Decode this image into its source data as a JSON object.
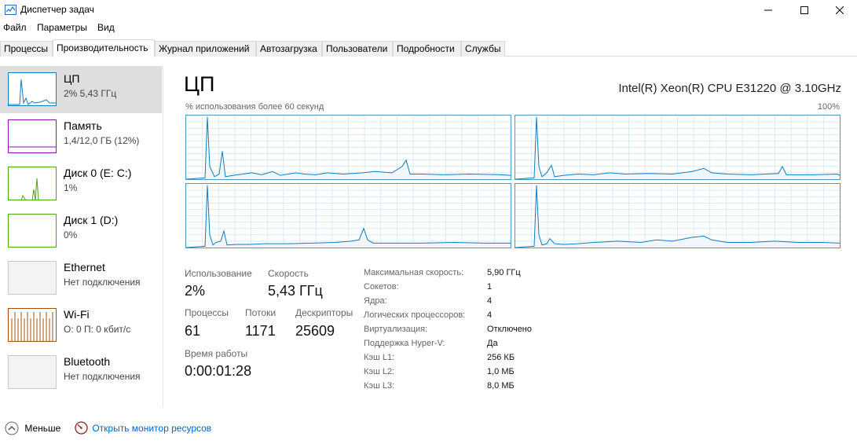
{
  "window": {
    "title": "Диспетчер задач",
    "minimize_icon": "minimize-icon",
    "maximize_icon": "maximize-icon",
    "close_icon": "close-icon"
  },
  "menu": [
    "Файл",
    "Параметры",
    "Вид"
  ],
  "tabs": [
    {
      "label": "Процессы",
      "active": false
    },
    {
      "label": "Производительность",
      "active": true
    },
    {
      "label": "Журнал приложений",
      "active": false
    },
    {
      "label": "Автозагрузка",
      "active": false
    },
    {
      "label": "Пользователи",
      "active": false
    },
    {
      "label": "Подробности",
      "active": false
    },
    {
      "label": "Службы",
      "active": false
    }
  ],
  "sidebar": [
    {
      "title": "ЦП",
      "subtitle": "2% 5,43 ГГц",
      "color": "#117dbb",
      "selected": true
    },
    {
      "title": "Память",
      "subtitle": "1,4/12,0 ГБ (12%)",
      "color": "#8b12ae",
      "selected": false
    },
    {
      "title": "Диск 0 (E: C:)",
      "subtitle": "1%",
      "color": "#4da60c",
      "selected": false
    },
    {
      "title": "Диск 1 (D:)",
      "subtitle": "0%",
      "color": "#4da60c",
      "selected": false
    },
    {
      "title": "Ethernet",
      "subtitle": "Нет подключения",
      "color": "#a0a0a0",
      "selected": false
    },
    {
      "title": "Wi-Fi",
      "subtitle": "О: 0 П: 0 кбит/с",
      "color": "#a74f01",
      "selected": false
    },
    {
      "title": "Bluetooth",
      "subtitle": "Нет подключения",
      "color": "#a0a0a0",
      "selected": false
    }
  ],
  "main": {
    "title": "ЦП",
    "cpu_name": "Intel(R) Xeon(R) CPU E31220 @ 3.10GHz",
    "graph_label": "% использования более 60 секунд",
    "graph_max": "100%",
    "accent_color": "#117dbb",
    "graph_fill": "#f1f6fa"
  },
  "stats": {
    "usage_label": "Использование",
    "usage_value": "2%",
    "speed_label": "Скорость",
    "speed_value": "5,43 ГГц",
    "processes_label": "Процессы",
    "processes_value": "61",
    "threads_label": "Потоки",
    "threads_value": "1171",
    "handles_label": "Дескрипторы",
    "handles_value": "25609",
    "uptime_label": "Время работы",
    "uptime_value": "0:00:01:28"
  },
  "properties": [
    {
      "key": "Максимальная скорость:",
      "value": "5,90 ГГц"
    },
    {
      "key": "Сокетов:",
      "value": "1"
    },
    {
      "key": "Ядра:",
      "value": "4"
    },
    {
      "key": "Логических процессоров:",
      "value": "4"
    },
    {
      "key": "Виртуализация:",
      "value": "Отключено"
    },
    {
      "key": "Поддержка Hyper-V:",
      "value": "Да"
    },
    {
      "key": "Кэш L1:",
      "value": "256 КБ"
    },
    {
      "key": "Кэш L2:",
      "value": "1,0 МБ"
    },
    {
      "key": "Кэш L3:",
      "value": "8,0 МБ"
    }
  ],
  "footer": {
    "fewer_label": "Меньше",
    "fewer_icon": "chevron-up-icon",
    "monitor_label": "Открыть монитор ресурсов",
    "monitor_icon": "resource-monitor-icon",
    "link_color": "#0066cc"
  }
}
